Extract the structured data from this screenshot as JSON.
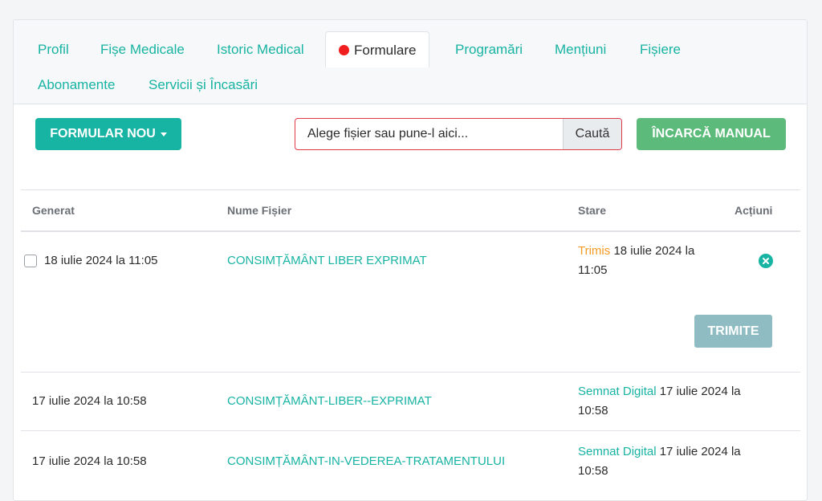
{
  "tabs": {
    "profil": "Profil",
    "fise_medicale": "Fișe Medicale",
    "istoric_medical": "Istoric Medical",
    "formulare": "Formulare",
    "programari": "Programări",
    "mentiuni": "Mențiuni",
    "fisiere": "Fișiere",
    "abonamente": "Abonamente",
    "servicii": "Servicii și Încasări",
    "active_tab": "Formulare"
  },
  "toolbar": {
    "new_form_label": "FORMULAR NOU",
    "file_placeholder": "Alege fișier sau pune-l aici...",
    "browse_label": "Caută",
    "manual_upload_label": "ÎNCARCĂ MANUAL"
  },
  "table": {
    "headers": {
      "generated": "Generat",
      "file_name": "Nume Fișier",
      "status": "Stare",
      "actions": "Acțiuni"
    },
    "rows": [
      {
        "generated": "18 iulie 2024 la 11:05",
        "file_name": "CONSIMȚĂMÂNT LIBER EXPRIMAT",
        "status_label": "Trimis",
        "status_date_line1": "18 iulie 2024 la",
        "status_date_line2": "11:05",
        "send_label": "TRIMITE"
      },
      {
        "generated": "17 iulie 2024 la 10:58",
        "file_name": "CONSIMȚĂMÂNT-LIBER--EXPRIMAT",
        "status_label": "Semnat Digital",
        "status_date_line1": "17 iulie 2024 la",
        "status_date_line2": "10:58"
      },
      {
        "generated": "17 iulie 2024 la 10:58",
        "file_name": "CONSIMȚĂMÂNT-IN-VEDEREA-TRATAMENTULUI",
        "status_label": "Semnat Digital",
        "status_date_line1": "17 iulie 2024 la",
        "status_date_line2": "10:58"
      }
    ]
  },
  "colors": {
    "accent": "#17b3a3",
    "upload_green": "#5cbb7a",
    "status_sent": "#f59a23",
    "active_dot": "#f01e1e",
    "send_button": "#8fbcc3"
  },
  "icons": {
    "new_form_caret": "caret-down-icon",
    "active_tab_indicator": "red-dot-icon",
    "row_action": "cancel-circle-icon"
  }
}
